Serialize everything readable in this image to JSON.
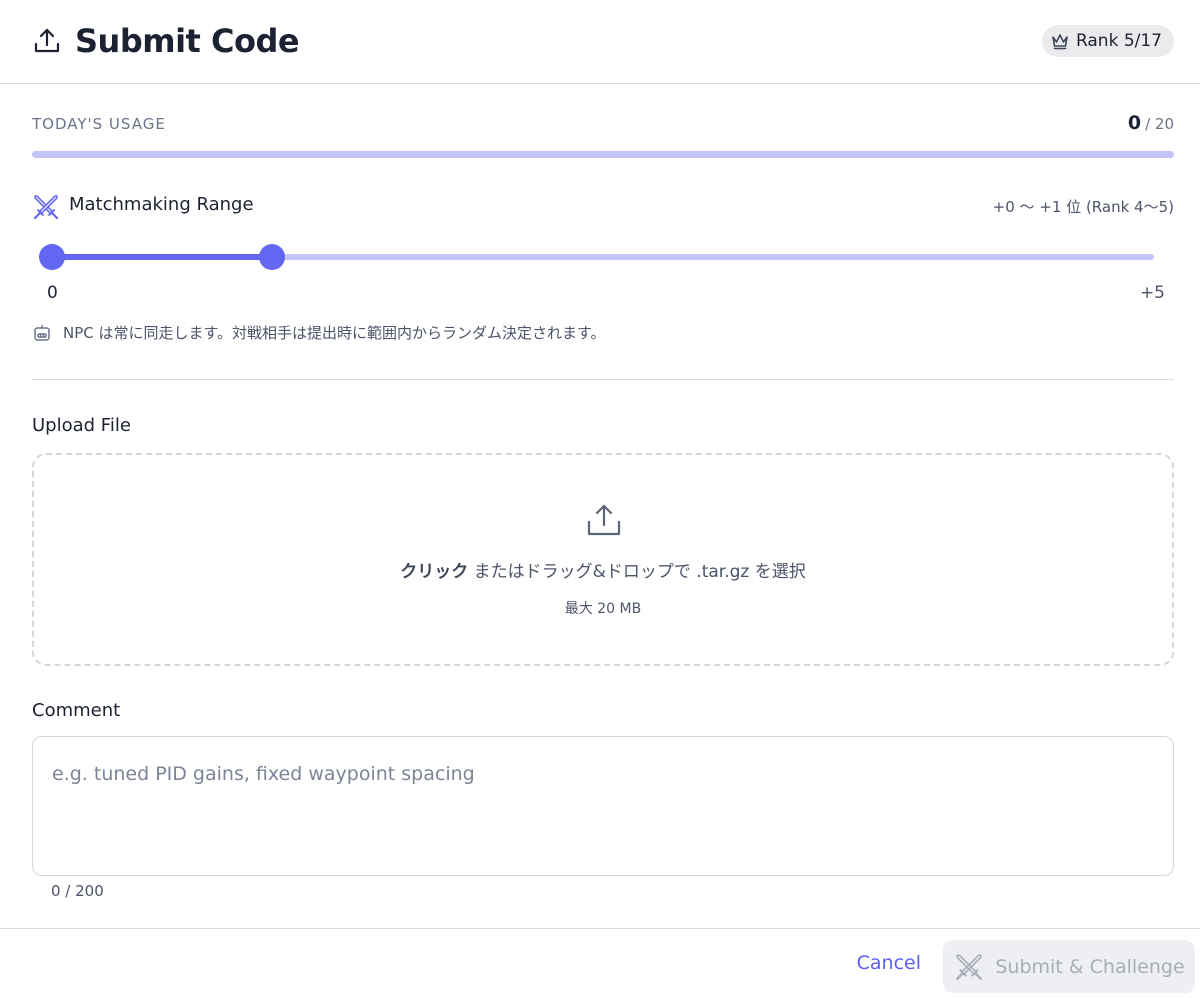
{
  "header": {
    "title": "Submit Code",
    "rank_badge": "Rank 5/17"
  },
  "usage": {
    "label": "TODAY'S USAGE",
    "used": "0",
    "limit_text": "/ 20",
    "used_value": 0,
    "limit_value": 20
  },
  "matchmaking": {
    "label": "Matchmaking Range",
    "range_text": "+0 〜 +1 位 (Rank 4〜5)",
    "slider_min_label": "0",
    "slider_max_label": "+5",
    "slider_min": 0,
    "slider_max": 5,
    "selected_low": 0,
    "selected_high": 1,
    "note": "NPC は常に同走します。対戦相手は提出時に範囲内からランダム決定されます。"
  },
  "upload": {
    "label": "Upload File",
    "drop_strong": "クリック",
    "drop_rest": " またはドラッグ&ドロップで .tar.gz を選択",
    "max_size": "最大 20 MB"
  },
  "comment": {
    "label": "Comment",
    "placeholder": "e.g. tuned PID gains, fixed waypoint spacing",
    "value": "",
    "char_count": "0 / 200"
  },
  "footer": {
    "cancel_label": "Cancel",
    "submit_label": "Submit & Challenge"
  },
  "colors": {
    "accent": "#6366f1",
    "accent_light": "#c2c3f7",
    "text_primary": "#1c2232",
    "text_muted": "#4b5468",
    "disabled_bg": "#eeeff2",
    "disabled_text": "#a9adb8"
  },
  "icons": {
    "header": "upload-icon",
    "rank": "crown-icon",
    "matchmaking": "crossed-swords-icon",
    "npc": "robot-icon",
    "dropzone": "upload-icon",
    "submit": "crossed-swords-icon"
  }
}
